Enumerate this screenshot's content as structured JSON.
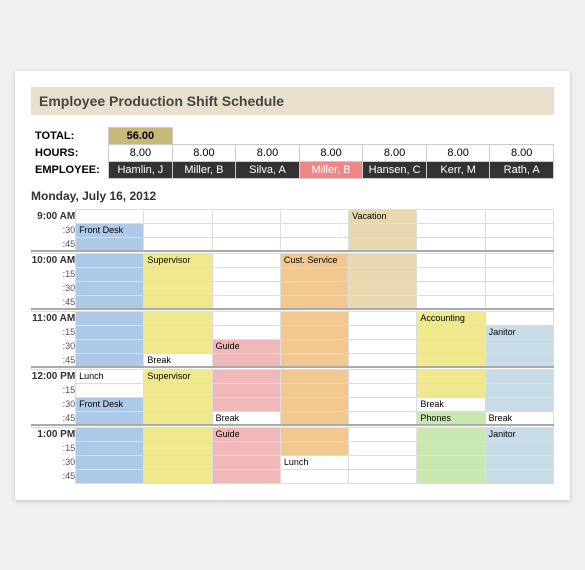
{
  "title": "Employee Production Shift Schedule",
  "summary": {
    "total_label": "TOTAL:",
    "total_value": "56.00",
    "hours_label": "HOURS:",
    "employee_label": "EMPLOYEE:"
  },
  "employees": [
    {
      "name": "Hamlin, J",
      "hours": "8.00",
      "class": "emp-hamlin"
    },
    {
      "name": "Miller, B",
      "hours": "8.00",
      "class": "emp-miller"
    },
    {
      "name": "Silva, A",
      "hours": "8.00",
      "class": "emp-silva"
    },
    {
      "name": "Miller, B",
      "hours": "8.00",
      "class": "emp-millerb"
    },
    {
      "name": "Hansen, C",
      "hours": "8.00",
      "class": "emp-hansen"
    },
    {
      "name": "Kerr, M",
      "hours": "8.00",
      "class": "emp-kerr"
    },
    {
      "name": "Rath, A",
      "hours": "8.00",
      "class": "emp-rath"
    }
  ],
  "day_label": "Monday, July 16, 2012",
  "times": [
    "9:00 AM",
    ":30",
    ":45",
    "10:00 AM",
    ":15",
    ":30",
    ":45",
    "11:00 AM",
    ":15",
    ":30",
    ":45",
    "12:00 PM",
    ":15",
    ":30",
    ":45",
    "1:00 PM",
    ":15",
    ":30",
    ":45"
  ]
}
